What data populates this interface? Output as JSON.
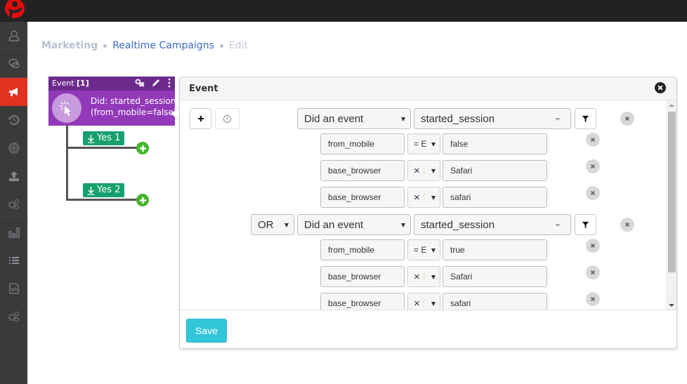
{
  "app": {
    "logo": "app-logo"
  },
  "sidebar": {
    "items": [
      {
        "icon": "user-icon",
        "active": false
      },
      {
        "icon": "chat-icon",
        "active": false
      },
      {
        "icon": "megaphone-icon",
        "active": true
      },
      {
        "icon": "history-icon",
        "active": false
      },
      {
        "icon": "target-icon",
        "active": false
      },
      {
        "icon": "upload-icon",
        "active": false
      },
      {
        "icon": "gears-icon",
        "active": false
      },
      {
        "icon": "bar-chart-icon",
        "active": false
      },
      {
        "icon": "list-icon",
        "active": false
      },
      {
        "icon": "code-file-icon",
        "active": false
      },
      {
        "icon": "settings-gears-icon",
        "active": false
      }
    ]
  },
  "breadcrumb": {
    "root": "Marketing",
    "link": "Realtime Campaigns",
    "current": "Edit"
  },
  "flow": {
    "event_node": {
      "title": "Event",
      "count": "[1]",
      "line1": "Did: started_session",
      "line2": "(from_mobile=false)"
    },
    "branches": [
      {
        "label": "Yes 1"
      },
      {
        "label": "Yes 2"
      }
    ]
  },
  "panel": {
    "title": "Event",
    "save_label": "Save",
    "groups": [
      {
        "connector": null,
        "condition": "Did an event",
        "event": "started_session",
        "filters": [
          {
            "property": "from_mobile",
            "operator": "= E",
            "value": "false"
          },
          {
            "property": "base_browser",
            "operator": "×",
            "value": "Safari"
          },
          {
            "property": "base_browser",
            "operator": "×",
            "value": "safari"
          }
        ]
      },
      {
        "connector": "OR",
        "condition": "Did an event",
        "event": "started_session",
        "filters": [
          {
            "property": "from_mobile",
            "operator": "= E",
            "value": "true"
          },
          {
            "property": "base_browser",
            "operator": "×",
            "value": "Safari"
          },
          {
            "property": "base_browser",
            "operator": "×",
            "value": "safari"
          }
        ]
      }
    ]
  },
  "colors": {
    "accent_red": "#e0321e",
    "node_purple": "#9239b9",
    "node_purple_dark": "#6c2b8c",
    "yes_green": "#16a06e",
    "add_green": "#45b52d",
    "save_cyan": "#33c6d9",
    "breadcrumb_link": "#3e6bc1"
  }
}
